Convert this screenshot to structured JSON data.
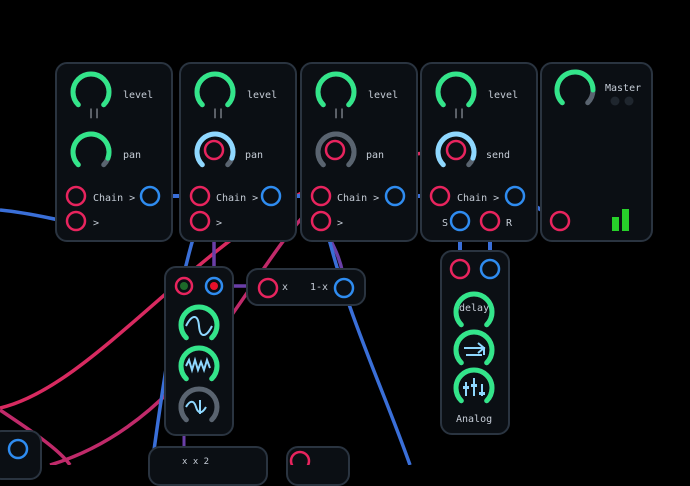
{
  "colors": {
    "background": "#000000",
    "panel": "#0b0f14",
    "panel_border": "#2a3440",
    "knob_green": "#33e58a",
    "knob_blue": "#8fd8ff",
    "knob_grey": "#5a6470",
    "port_red": "#e8245e",
    "port_blue": "#2f8cf0",
    "cable_blue": "#3a6fd8",
    "cable_purple": "#6a3fa8",
    "cable_pink": "#d82a60",
    "meter_green": "#27d12a"
  },
  "channels": [
    {
      "level_label": "level",
      "pause_label": "||",
      "pan_label": "pan",
      "chain_label": "Chain >",
      "out_label": ">"
    },
    {
      "level_label": "level",
      "pause_label": "||",
      "pan_label": "pan",
      "chain_label": "Chain >",
      "out_label": ">"
    },
    {
      "level_label": "level",
      "pause_label": "||",
      "pan_label": "pan",
      "chain_label": "Chain >",
      "out_label": ">"
    },
    {
      "level_label": "level",
      "pause_label": "||",
      "send_label": "send",
      "chain_label": "Chain >",
      "send_port_label": "S",
      "return_port_label": "R"
    }
  ],
  "master": {
    "title": "Master"
  },
  "crossfader": {
    "x_label": "x",
    "one_minus_x_label": "1-x"
  },
  "lfo": {
    "icons": [
      "sine-wave-icon",
      "noise-wave-icon",
      "modulated-wave-icon"
    ]
  },
  "effect": {
    "delay_label": "delay",
    "name_label": "Analog",
    "icons": [
      "loop-icon",
      "mixer-sliders-icon"
    ]
  },
  "partial_bottom": {
    "label_fragment": "x   x 2"
  }
}
